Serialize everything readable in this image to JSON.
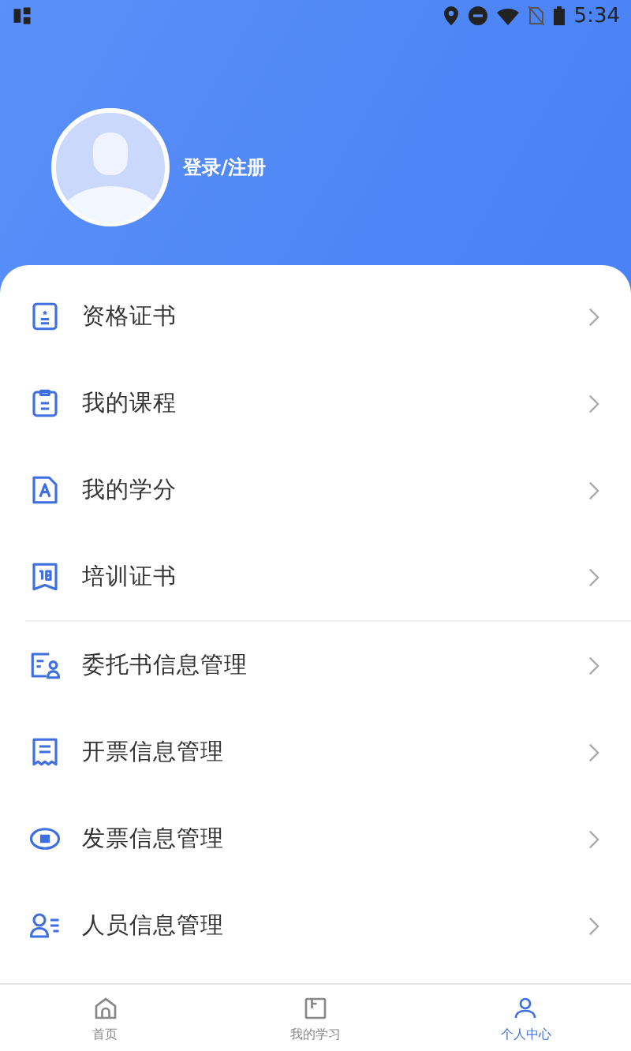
{
  "status_bar": {
    "time": "5:34"
  },
  "profile": {
    "login_label": "登录/注册"
  },
  "menu_groups": [
    {
      "items": [
        {
          "label": "资格证书"
        },
        {
          "label": "我的课程"
        },
        {
          "label": "我的学分"
        },
        {
          "label": "培训证书"
        }
      ]
    },
    {
      "items": [
        {
          "label": "委托书信息管理"
        },
        {
          "label": "开票信息管理"
        },
        {
          "label": "发票信息管理"
        },
        {
          "label": "人员信息管理"
        }
      ]
    }
  ],
  "bottom_nav": [
    {
      "label": "首页",
      "selected": false
    },
    {
      "label": "我的学习",
      "selected": false
    },
    {
      "label": "个人中心",
      "selected": true
    }
  ]
}
